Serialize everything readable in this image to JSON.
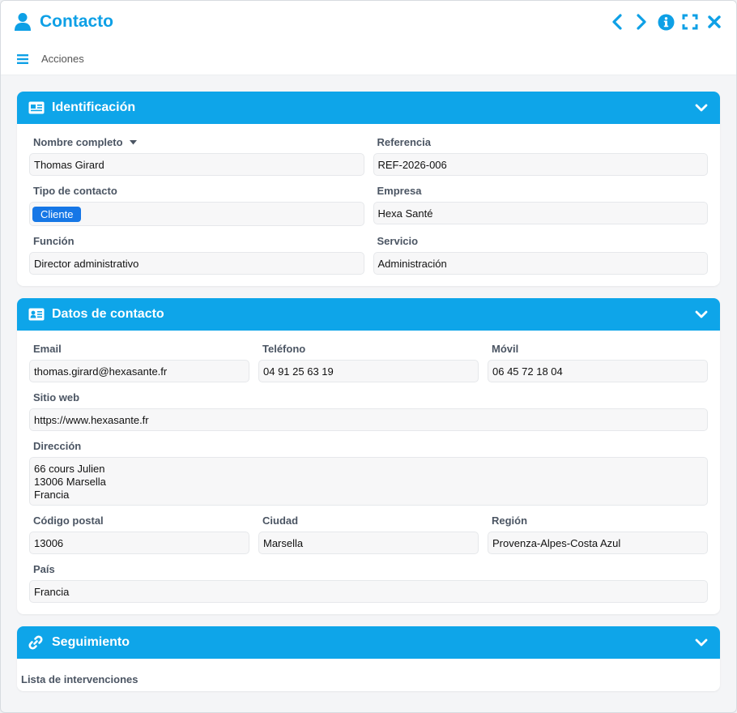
{
  "window": {
    "title": "Contacto",
    "icons": [
      "user-icon",
      "chevron-left-icon",
      "chevron-right-icon",
      "info-icon",
      "fullscreen-icon",
      "close-icon"
    ],
    "accent": "#0ea5e9",
    "title_color": "#0ea0e6"
  },
  "menu": {
    "label": "Acciones",
    "icon": "hamburger-icon"
  },
  "identificacion": {
    "title": "Identificación",
    "icon": "id-card-icon",
    "nombre_label": "Nombre completo",
    "nombre_value": "Thomas Girard",
    "referencia_label": "Referencia",
    "referencia_value": "REF-2026-006",
    "tipo_label": "Tipo de contacto",
    "tipo_value": "Cliente",
    "tipo_badge_color": "#1677e6",
    "empresa_label": "Empresa",
    "empresa_value": "Hexa Santé",
    "funcion_label": "Función",
    "funcion_value": "Director administrativo",
    "servicio_label": "Servicio",
    "servicio_value": "Administración"
  },
  "datos": {
    "title": "Datos de contacto",
    "icon": "contact-card-icon",
    "email_label": "Email",
    "email_value": "thomas.girard@hexasante.fr",
    "telefono_label": "Teléfono",
    "telefono_value": "04 91 25 63 19",
    "movil_label": "Móvil",
    "movil_value": "06 45 72 18 04",
    "web_label": "Sitio web",
    "web_value": "https://www.hexasante.fr",
    "direccion_label": "Dirección",
    "direccion_value": "66 cours Julien\n13006 Marsella\nFrancia",
    "cp_label": "Código postal",
    "cp_value": "13006",
    "ciudad_label": "Ciudad",
    "ciudad_value": "Marsella",
    "region_label": "Región",
    "region_value": "Provenza-Alpes-Costa Azul",
    "pais_label": "País",
    "pais_value": "Francia"
  },
  "seguimiento": {
    "title": "Seguimiento",
    "icon": "link-icon",
    "lista_label": "Lista de intervenciones"
  }
}
